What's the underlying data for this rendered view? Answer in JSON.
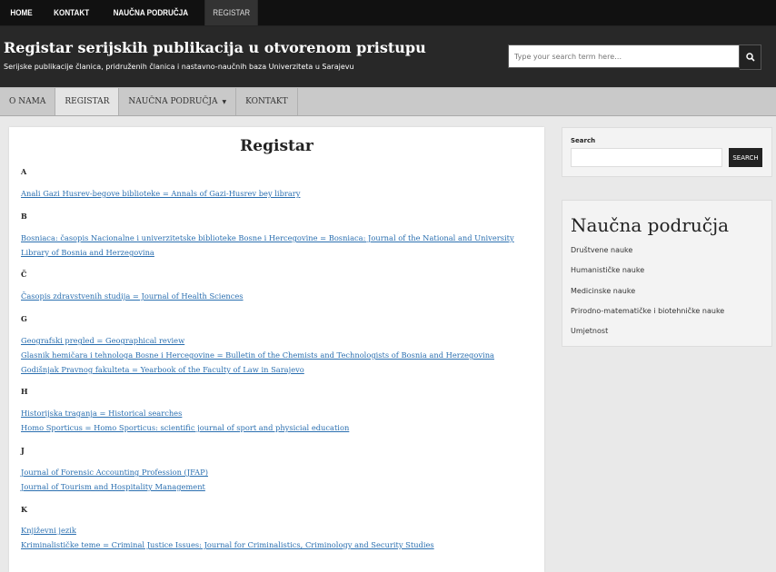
{
  "topbar": [
    "HOME",
    "KONTAKT",
    "NAUČNA PODRUČJA",
    "REGISTAR"
  ],
  "header": {
    "title": "Registar serijskih publikacija u otvorenom pristupu",
    "description": "Serijske publikacije članica, pridruženih članica i nastavno-naučnih baza Univerziteta u Sarajevu",
    "search_placeholder": "Type your search term here…"
  },
  "mainnav": {
    "o_nama": "O NAMA",
    "registar": "REGISTAR",
    "naucna": "NAUČNA PODRUČJA",
    "kontakt": "KONTAKT"
  },
  "content": {
    "title": "Registar",
    "sections": [
      {
        "letter": "A",
        "entries": [
          "Anali Gazi Husrev-begove biblioteke = Annals of Gazi-Husrev bey library"
        ]
      },
      {
        "letter": "B",
        "entries": [
          "Bosniaca: časopis Nacionalne i univerzitetske biblioteke Bosne i Hercegovine = Bosniaca: Journal of the National and University Library of Bosnia and Herzegovina"
        ]
      },
      {
        "letter": "Č",
        "entries": [
          "Časopis zdravstvenih studija = Journal of Health Sciences"
        ]
      },
      {
        "letter": "G",
        "entries": [
          "Geografski pregled = Geographical review",
          "Glasnik hemičara i tehnologa Bosne i Hercegovine = Bulletin of the Chemists and Technologists of Bosnia and Herzegovina",
          "Godišnjak Pravnog fakulteta = Yearbook of the Faculty of Law in Sarajevo"
        ]
      },
      {
        "letter": "H",
        "entries": [
          "Historijska traganja = Historical searches",
          "Homo Sporticus = Homo Sporticus: scientific journal of sport and physicial education"
        ]
      },
      {
        "letter": "J",
        "entries": [
          "Journal of Forensic Accounting Profession (JFAP)",
          "Journal of Tourism and Hospitality Management"
        ]
      },
      {
        "letter": "K",
        "entries": [
          "Književni jezik",
          "Kriminalističke teme = Criminal Justice Issues: Journal for Criminalistics, Criminology and Security Studies"
        ]
      }
    ]
  },
  "sidebar": {
    "search_label": "Search",
    "search_button": "SEARCH",
    "areas_title": "Naučna područja",
    "areas": [
      "Društvene nauke",
      "Humanističke nauke",
      "Medicinske nauke",
      "Prirodno-matematičke i biotehničke nauke",
      "Umjetnost"
    ]
  }
}
